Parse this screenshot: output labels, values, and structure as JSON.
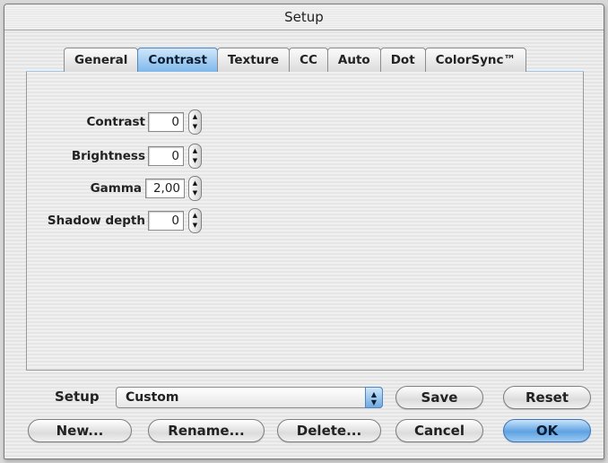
{
  "window": {
    "title": "Setup"
  },
  "tabs": [
    "General",
    "Contrast",
    "Texture",
    "CC",
    "Auto",
    "Dot",
    "ColorSync™"
  ],
  "active_tab": "Contrast",
  "fields": [
    {
      "label": "Contrast",
      "value": "0"
    },
    {
      "label": "Brightness",
      "value": "0"
    },
    {
      "label": "Gamma",
      "value": "2,00"
    },
    {
      "label": "Shadow depth",
      "value": "0"
    }
  ],
  "setup": {
    "label": "Setup",
    "selected": "Custom"
  },
  "buttons": {
    "save": "Save",
    "reset": "Reset",
    "new": "New...",
    "rename": "Rename...",
    "delete": "Delete...",
    "cancel": "Cancel",
    "ok": "OK"
  },
  "colors": {
    "accent": "#6fa9e0",
    "tab_active": "#7fb8ea"
  }
}
